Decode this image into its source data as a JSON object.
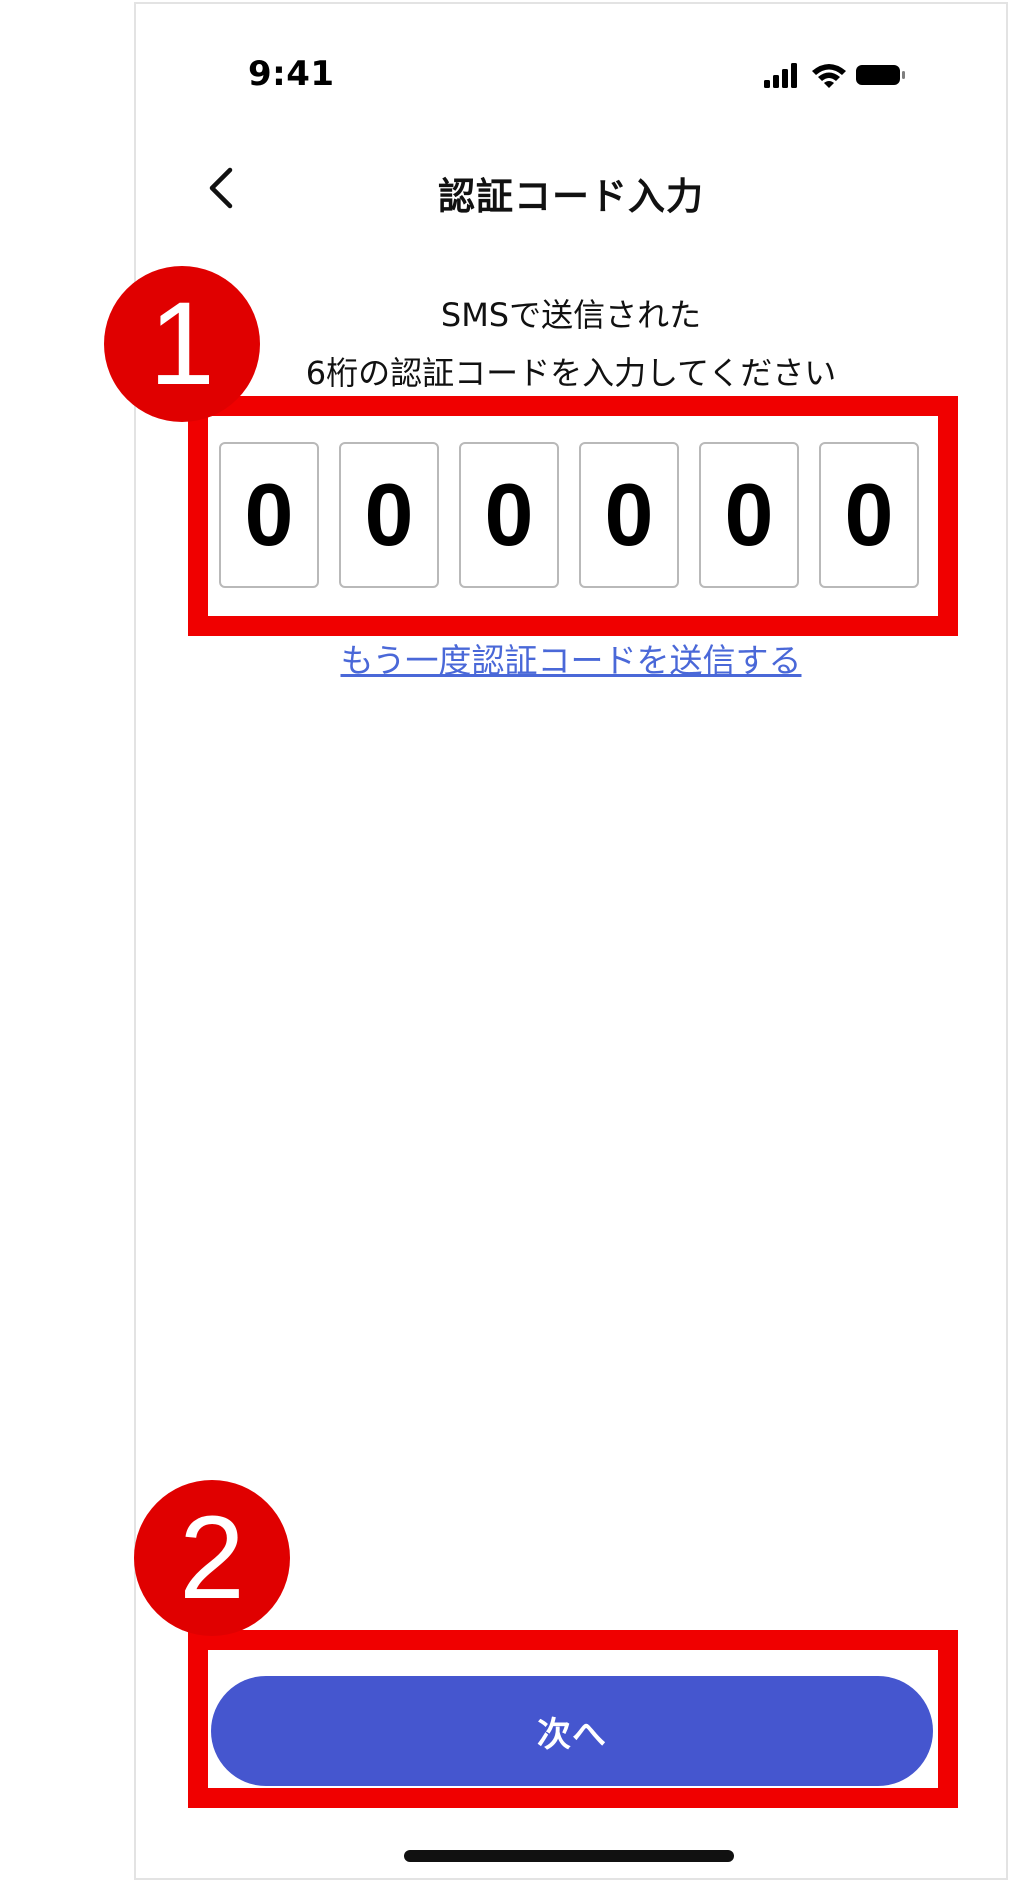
{
  "status_bar": {
    "time": "9:41",
    "icons": [
      "signal-icon",
      "wifi-icon",
      "battery-icon"
    ]
  },
  "nav": {
    "back_icon": "chevron-left-icon",
    "title": "認証コード入力"
  },
  "instruction": {
    "line1": "SMSで送信された",
    "line2": "6桁の認証コードを入力してください"
  },
  "code_digits": [
    "0",
    "0",
    "0",
    "0",
    "0",
    "0"
  ],
  "resend_link": "もう一度認証コードを送信する",
  "next_button": "次へ",
  "annotations": {
    "marker1": "1",
    "marker2": "2"
  },
  "colors": {
    "primary_button": "#4556cf",
    "link": "#4a68d8",
    "annotation": "#e00000"
  }
}
